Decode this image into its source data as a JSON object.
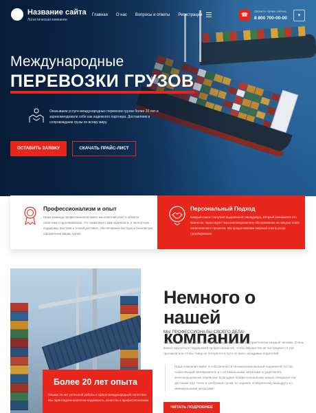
{
  "header": {
    "site_name": "Название сайта",
    "site_sub": "Логистическая компания",
    "nav": [
      "Главная",
      "О нас",
      "Вопросы и ответы",
      "Регистрация"
    ],
    "call_label": "Звоните прямо сейчас",
    "phone": "8 800 700-00-00"
  },
  "hero": {
    "title_line1": "Международные",
    "title_line2": "ПЕРЕВОЗКИ ГРУЗОВ",
    "description": "Оказываем услуги международных перевозок грузов более 20 лет и зарекомендовали себя как надежного партнера. Доставляем и сопровождаем грузы по всему миру.",
    "btn_order": "ОСТАВИТЬ ЗАЯВКУ",
    "btn_price": "СКАЧАТЬ ПРАЙС-ЛИСТ"
  },
  "features": [
    {
      "title": "Профессионализм и опыт",
      "text": "Наша команда профессионалов имеет многолетний опыт в области логистики и грузоперевозок, что гарантирует вам надежность и экспертную поддержку. Быстрая и точная доставка, обеспечиваем быструю и безопасную оформление ваших грузов"
    },
    {
      "title": "Персональный Подход",
      "text": "Каждый клиент получает выделенного менеджера, который занимается его проектом, гарантирует персонализированное обслуживание на каждом этапе логистического процесса. Мы предоставляем широкий спектр услуг грузоперевозок"
    }
  ],
  "about": {
    "exp_title": "Более 20 лет опыта",
    "exp_text": "Свыше 20 лет успешной работы в сфере международной логистики. Мы гарантируем клиентам надежность, качество и профессионализм.",
    "title": "Немного о нашей компании",
    "subtitle": "МЫ ПРОФЕССИОНАЛЫ СВОЕГО ДЕЛА!",
    "p1": "Сегодня с вопросом транспортировки грузов сталкивается практически каждый человек. Очень важно заручиться поддержкой профессионалов, чтобы имущество не пострадало от рук грузчиков или чтобы товар не потерялся в пути по вине нерадивых водителей.",
    "p2": "Наша компания имеет в собственности специализированный подвижной состав, позволяющий своевременно и с оптимальными затратами осуществлять железнодорожные перевозки. Благодаря профессионализму наших специалистов доставим груз точно в требуемые сроки, по заранее оговоренному маршруту и с минимальными затратами!",
    "btn_more": "ЧИТАТЬ ПОДРОБНЕЕ"
  },
  "colors": {
    "accent": "#e8261b",
    "dark_blue": "#0b2f57"
  }
}
